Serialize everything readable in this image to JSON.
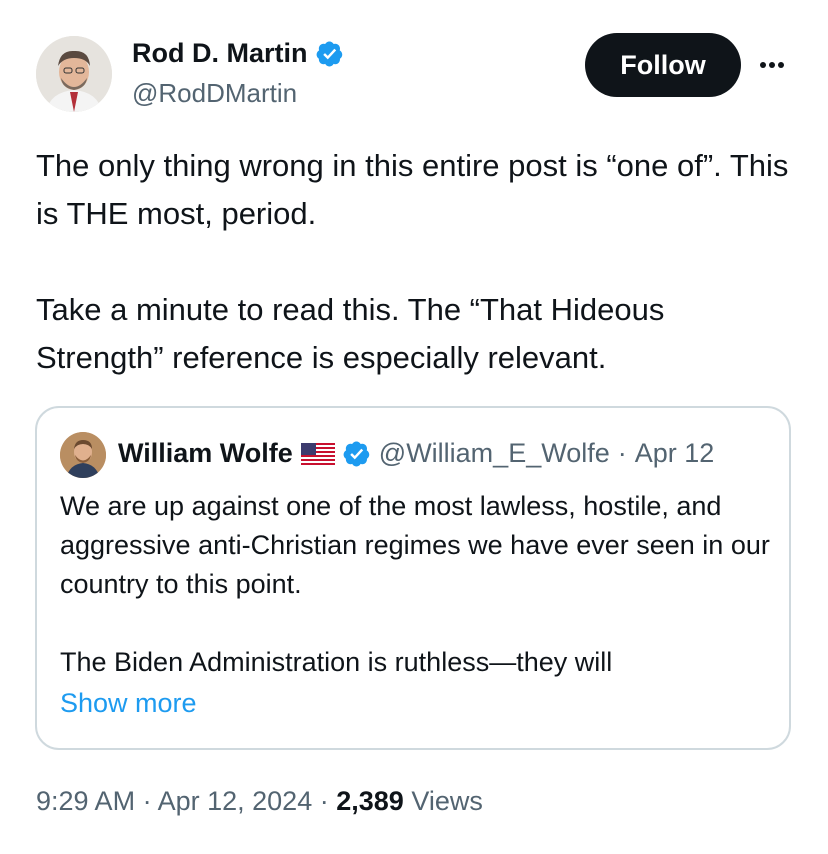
{
  "author": {
    "name": "Rod D. Martin",
    "handle": "@RodDMartin",
    "verified_color": "#1d9bf0"
  },
  "actions": {
    "follow_label": "Follow",
    "more_icon": "more-horizontal-icon"
  },
  "post": {
    "paragraphs": [
      "The only thing wrong in this entire post is “one of”. This is THE most, period.",
      "Take a minute to read this. The “That Hideous Strength” reference is especially relevant."
    ]
  },
  "quote": {
    "name": "William Wolfe",
    "flag_icon": "us-flag-icon",
    "handle": "@William_E_Wolfe",
    "separator": "·",
    "date": "Apr 12",
    "paragraphs": [
      "We are up against one of the most lawless, hostile, and aggressive anti-Christian regimes we have ever seen in our country to this point.",
      "The Biden Administration is ruthless—they will"
    ],
    "show_more": "Show more"
  },
  "footer": {
    "time": "9:29 AM",
    "separator": "·",
    "date": "Apr 12, 2024",
    "views_count": "2,389",
    "views_label": "Views"
  },
  "colors": {
    "text": "#0f1419",
    "secondary": "#536471",
    "link": "#1d9bf0",
    "border": "#cfd9de"
  }
}
